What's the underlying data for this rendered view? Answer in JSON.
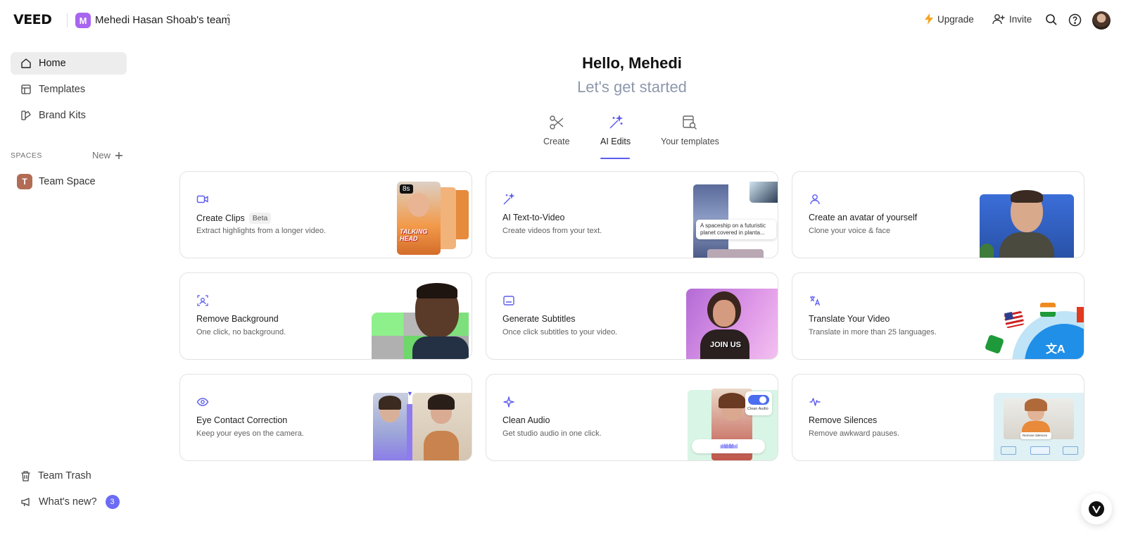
{
  "app": {
    "logo": "VEED"
  },
  "team": {
    "initial": "M",
    "name": "Mehedi Hasan Shoab's team"
  },
  "header": {
    "upgrade_label": "Upgrade",
    "invite_label": "Invite"
  },
  "sidebar": {
    "items": [
      {
        "label": "Home",
        "icon": "home-icon",
        "active": true
      },
      {
        "label": "Templates",
        "icon": "templates-icon"
      },
      {
        "label": "Brand Kits",
        "icon": "brand-kits-icon"
      }
    ],
    "spaces_label": "SPACES",
    "new_label": "New",
    "spaces": [
      {
        "initial": "T",
        "label": "Team Space"
      }
    ],
    "bottom": [
      {
        "label": "Team Trash",
        "icon": "trash-icon"
      },
      {
        "label": "What's new?",
        "icon": "megaphone-icon",
        "count": "3"
      }
    ]
  },
  "main": {
    "greeting": "Hello, Mehedi",
    "subtitle": "Let's get started",
    "tabs": [
      {
        "label": "Create",
        "icon": "scissors-icon"
      },
      {
        "label": "AI Edits",
        "icon": "magic-wand-icon",
        "active": true
      },
      {
        "label": "Your templates",
        "icon": "template-search-icon"
      }
    ],
    "cards": [
      {
        "title": "Create Clips",
        "badge": "Beta",
        "desc": "Extract highlights from a longer video.",
        "icon": "video-camera-icon",
        "thumb_text": "8s",
        "thumb_caption": "TALKING HEAD"
      },
      {
        "title": "AI Text-to-Video",
        "desc": "Create videos from your text.",
        "icon": "magic-wand-icon",
        "thumb_text": "A spaceship on a futuristic planet covered in planta..."
      },
      {
        "title": "Create an avatar of yourself",
        "desc": "Clone your voice & face",
        "icon": "person-icon"
      },
      {
        "title": "Remove Background",
        "desc": "One click, no background.",
        "icon": "person-focus-icon"
      },
      {
        "title": "Generate Subtitles",
        "desc": "Once click subtitles to your video.",
        "icon": "subtitles-icon",
        "thumb_text": "JOIN US"
      },
      {
        "title": "Translate Your Video",
        "desc": "Translate in more than 25 languages.",
        "icon": "translate-icon"
      },
      {
        "title": "Eye Contact Correction",
        "desc": "Keep your eyes on the camera.",
        "icon": "eye-icon"
      },
      {
        "title": "Clean Audio",
        "desc": "Get studio audio in one click.",
        "icon": "sparkle-icon",
        "thumb_text": "Clean Audio"
      },
      {
        "title": "Remove Silences",
        "desc": "Remove awkward pauses.",
        "icon": "waveform-icon",
        "thumb_text": "Remove Silences"
      }
    ]
  },
  "colors": {
    "accent": "#5b5bf0",
    "team_avatar": "#a865f0",
    "space_badge": "#b26b55",
    "upgrade_bolt": "#f5a524",
    "subtitle": "#8e98ad"
  }
}
